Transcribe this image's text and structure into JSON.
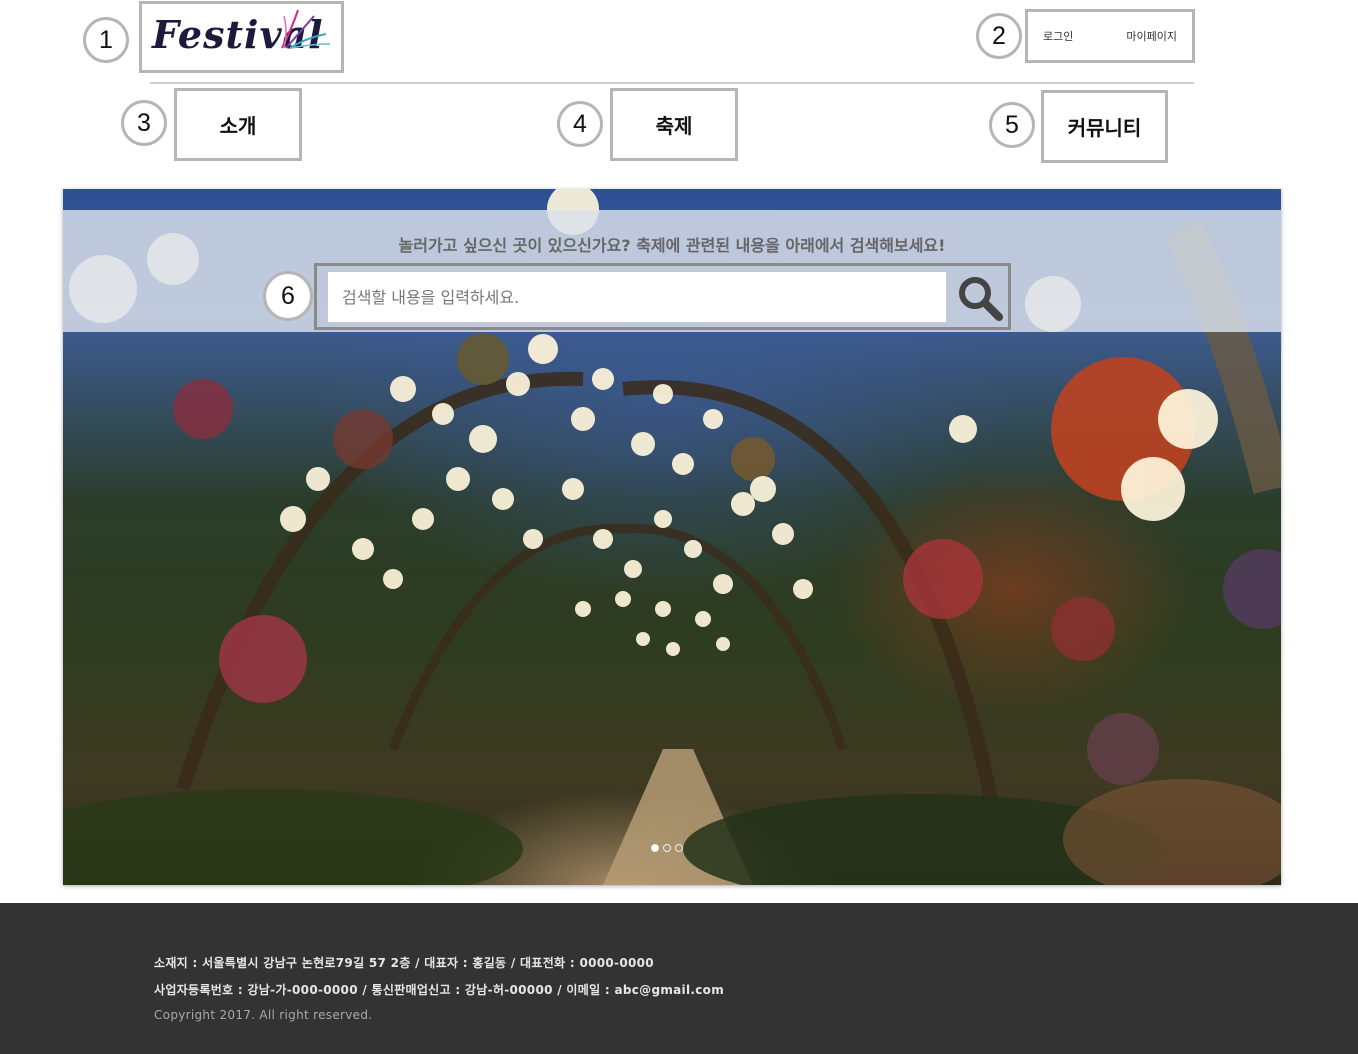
{
  "annotations": [
    "1",
    "2",
    "3",
    "4",
    "5",
    "6"
  ],
  "logo": {
    "text": "Festival"
  },
  "auth": {
    "login": "로그인",
    "mypage": "마이페이지"
  },
  "nav": [
    {
      "label": "소개"
    },
    {
      "label": "축제"
    },
    {
      "label": "커뮤니티"
    }
  ],
  "hero": {
    "prompt": "놀러가고 싶으신 곳이 있으신가요? 축제에 관련된 내용을 아래에서 검색해보세요!",
    "search_placeholder": "검색할 내용을 입력하세요.",
    "search_icon": "search-icon",
    "slide_count": 3,
    "active_slide": 1
  },
  "footer": {
    "line1": "소재지 : 서울특별시 강남구 논현로79길 57 2층 / 대표자 : 홍길동 / 대표전화 : 0000-0000",
    "line2": "사업자등록번호 : 강남-가-000-0000 / 통신판매업신고 : 강남-허-00000 / 이메일 : abc@gmail.com",
    "copyright": "Copyright 2017. All right reserved."
  },
  "colors": {
    "footer_bg": "#333333",
    "frame_border": "#b5b5b5",
    "search_band": "#dce2ec",
    "logo_text": "#1d1a3e"
  }
}
